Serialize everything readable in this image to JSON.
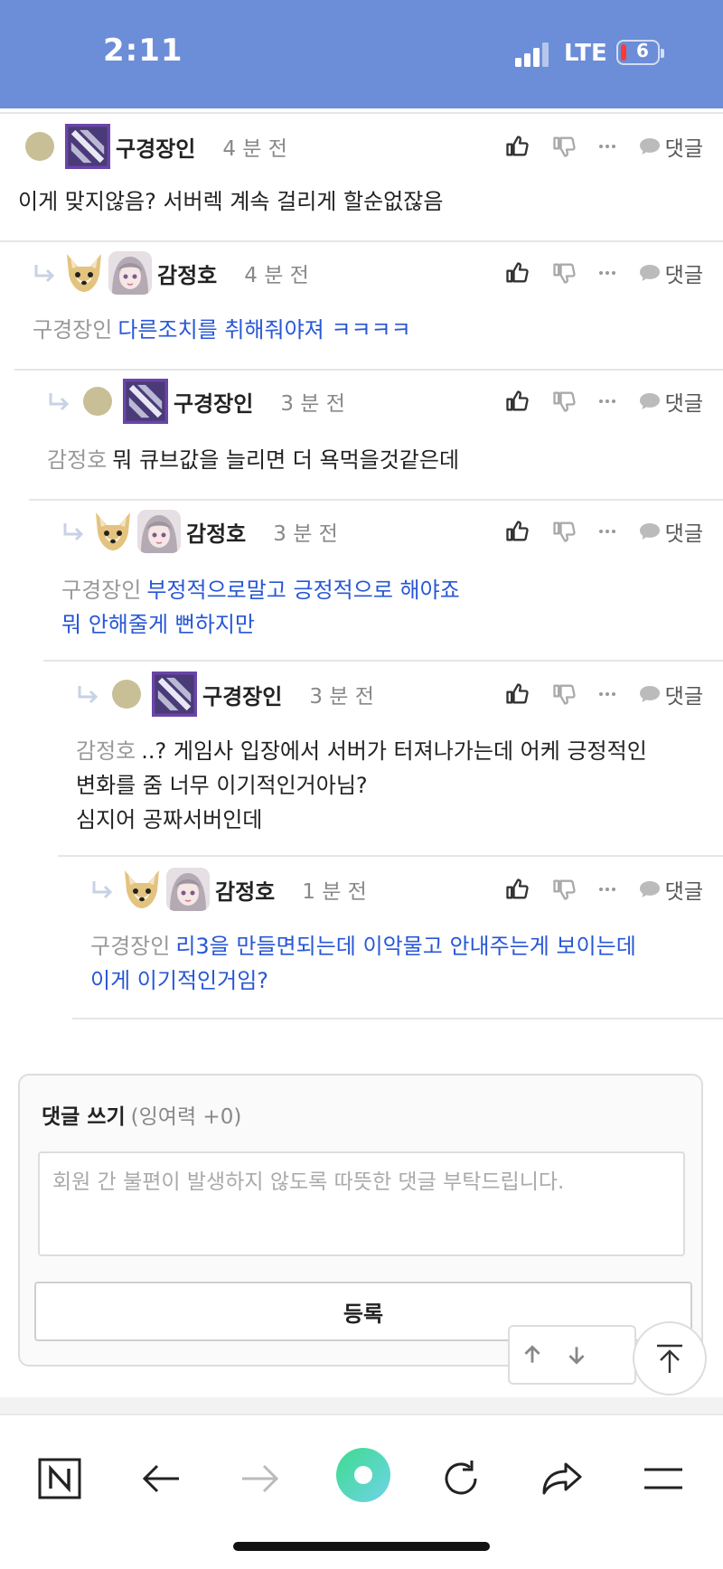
{
  "status_bar": {
    "time": "2:11",
    "network": "LTE",
    "battery": "6"
  },
  "comments": [
    {
      "author": "구경장인",
      "time": "4 분 전",
      "mention": "",
      "text": "이게 맞지않음? 서버렉 계속 걸리게 할순없잖음",
      "reply_label": "댓글"
    },
    {
      "author": "감정호",
      "time": "4 분 전",
      "mention": "구경장인",
      "text": "다른조치를 취해줘야져 ㅋㅋㅋㅋ",
      "reply_label": "댓글"
    },
    {
      "author": "구경장인",
      "time": "3 분 전",
      "mention": "감정호",
      "text": "뭐 큐브값을 늘리면 더 욕먹을것같은데",
      "reply_label": "댓글"
    },
    {
      "author": "감정호",
      "time": "3 분 전",
      "mention": "구경장인",
      "text": "부정적으로말고 긍정적으로 해야죠\n뭐 안해줄게 뻔하지만",
      "reply_label": "댓글"
    },
    {
      "author": "구경장인",
      "time": "3 분 전",
      "mention": "감정호",
      "text": "..? 게임사 입장에서 서버가 터져나가는데 어케 긍정적인\n변화를 줌 너무 이기적인거아님?\n심지어 공짜서버인데",
      "reply_label": "댓글"
    },
    {
      "author": "감정호",
      "time": "1 분 전",
      "mention": "구경장인",
      "text": "리3을 만들면되는데 이악물고 안내주는게 보이는데\n이게 이기적인거임?",
      "reply_label": "댓글"
    }
  ],
  "write": {
    "title": "댓글 쓰기",
    "subtitle": "(잉여력 +0)",
    "placeholder": "회원 간 불편이 발생하지 않도록 따뜻한 댓글 부탁드립니다.",
    "submit_label": "등록"
  },
  "colors": {
    "status_bar": "#6c8dd8",
    "link_blue": "#2857d6",
    "mention_gray": "#999999"
  },
  "icons": [
    "thumbs-up-icon",
    "thumbs-down-icon",
    "more-icon",
    "speech-bubble-icon",
    "reply-arrow-icon",
    "arrow-up-icon",
    "arrow-down-icon",
    "scroll-to-top-icon",
    "naver-home-icon",
    "back-icon",
    "forward-icon",
    "green-dot-icon",
    "refresh-icon",
    "share-icon",
    "menu-icon"
  ]
}
